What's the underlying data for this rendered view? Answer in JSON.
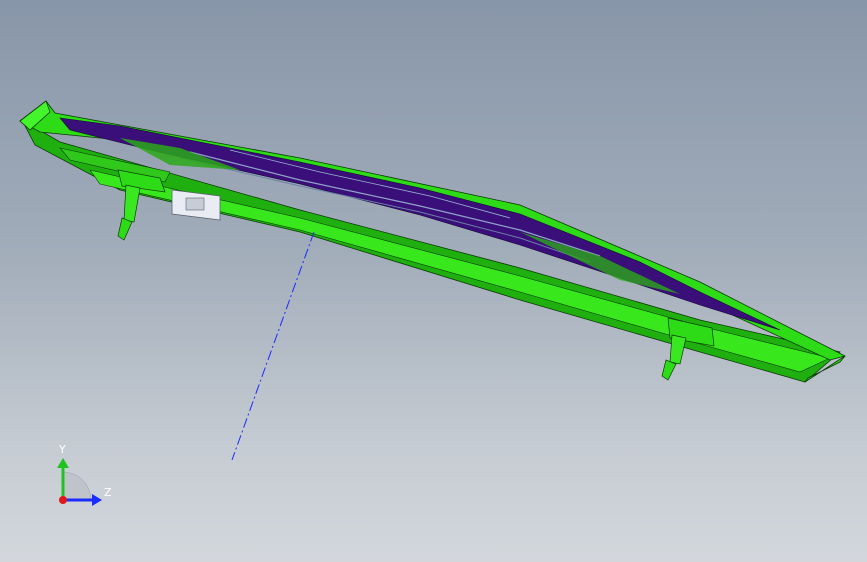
{
  "viewport": {
    "background_top": "#8896a9",
    "background_bottom": "#d3d7dc"
  },
  "model": {
    "body_color": "#2ddb16",
    "dark_body_color": "#1c9e0c",
    "face_color": "#3a0f7a",
    "edge_color": "#0b3a06",
    "connector_color": "#e9ecf2"
  },
  "axis_line": {
    "color": "#1a2cff"
  },
  "triad": {
    "y_label": "Y",
    "z_label": "Z",
    "y_color": "#1fc21f",
    "z_color": "#1a2cff",
    "x_color": "#e01818"
  }
}
